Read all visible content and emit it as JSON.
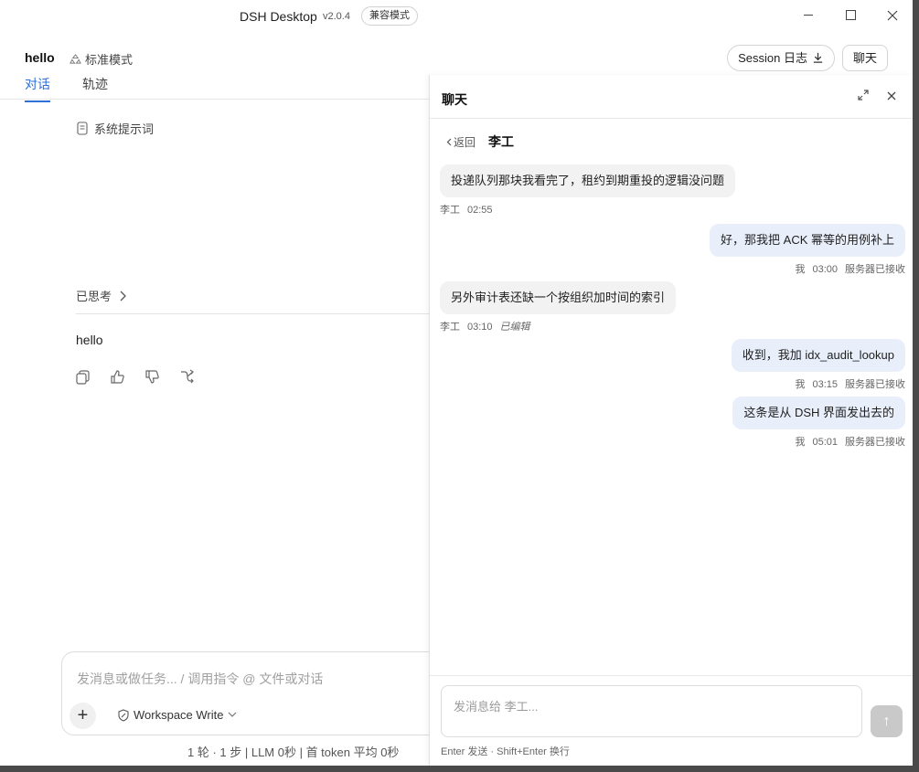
{
  "titlebar": {
    "app_name": "DSH Desktop",
    "version": "v2.0.4",
    "compat_badge": "兼容模式"
  },
  "conversation": {
    "title": "hello",
    "mode": "标准模式",
    "tabs": [
      {
        "label": "对话",
        "active": true
      },
      {
        "label": "轨迹",
        "active": false
      }
    ],
    "system_prompt_label": "系统提示词",
    "thought_label": "已思考",
    "reply_text": "hello"
  },
  "header_actions": {
    "session_log_label": "Session 日志",
    "chat_label": "聊天"
  },
  "composer": {
    "placeholder": "发消息或做任务... / 调用指令 @ 文件或对话",
    "add_symbol": "+",
    "workspace_mode": "Workspace Write"
  },
  "footer_stats": "1 轮 · 1 步  |  LLM 0秒  |  首 token 平均 0秒",
  "chat_panel": {
    "title": "聊天",
    "back_label": "返回",
    "peer_name": "李工",
    "messages": [
      {
        "direction": "in",
        "text": "投递队列那块我看完了，租约到期重投的逻辑没问题",
        "sender": "李工",
        "time": "02:55",
        "status": ""
      },
      {
        "direction": "out",
        "text": "好，那我把 ACK 幂等的用例补上",
        "sender": "我",
        "time": "03:00",
        "status": "服务器已接收"
      },
      {
        "direction": "in",
        "text": "另外审计表还缺一个按组织加时间的索引",
        "sender": "李工",
        "time": "03:10",
        "status": "已编辑"
      },
      {
        "direction": "out",
        "text": "收到，我加 idx_audit_lookup",
        "sender": "我",
        "time": "03:15",
        "status": "服务器已接收"
      },
      {
        "direction": "out",
        "text": "这条是从 DSH 界面发出去的",
        "sender": "我",
        "time": "05:01",
        "status": "服务器已接收"
      }
    ],
    "input_placeholder": "发消息给 李工...",
    "hint": "Enter 发送 · Shift+Enter 换行",
    "send_symbol": "↑"
  },
  "colors": {
    "accent": "#2f6fd8",
    "outgoing_bubble": "#e8effb",
    "incoming_bubble": "#f2f2f2"
  }
}
